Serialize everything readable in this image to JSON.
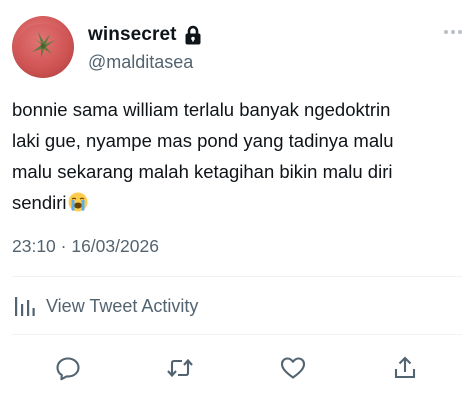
{
  "user": {
    "display_name": "winsecret",
    "handle": "@malditasea",
    "locked_icon": "lock-icon",
    "avatar": "tomato-avatar"
  },
  "tweet": {
    "text": "bonnie sama william terlalu banyak ngedoktrin\nlaki gue, nyampe mas pond yang tadinya malu\nmalu sekarang malah ketagihan bikin malu diri\nsendiri",
    "emoji": "loudly-crying-face-emoji",
    "timestamp": "23:10 · 16/03/2026"
  },
  "activity": {
    "label": "View Tweet Activity",
    "icon": "bar-chart-icon"
  },
  "actions": {
    "reply_icon": "reply-icon",
    "retweet_icon": "retweet-icon",
    "like_icon": "heart-icon",
    "share_icon": "share-icon"
  },
  "colors": {
    "text": "#0f1419",
    "secondary": "#536471",
    "divider": "#eff3f4"
  }
}
